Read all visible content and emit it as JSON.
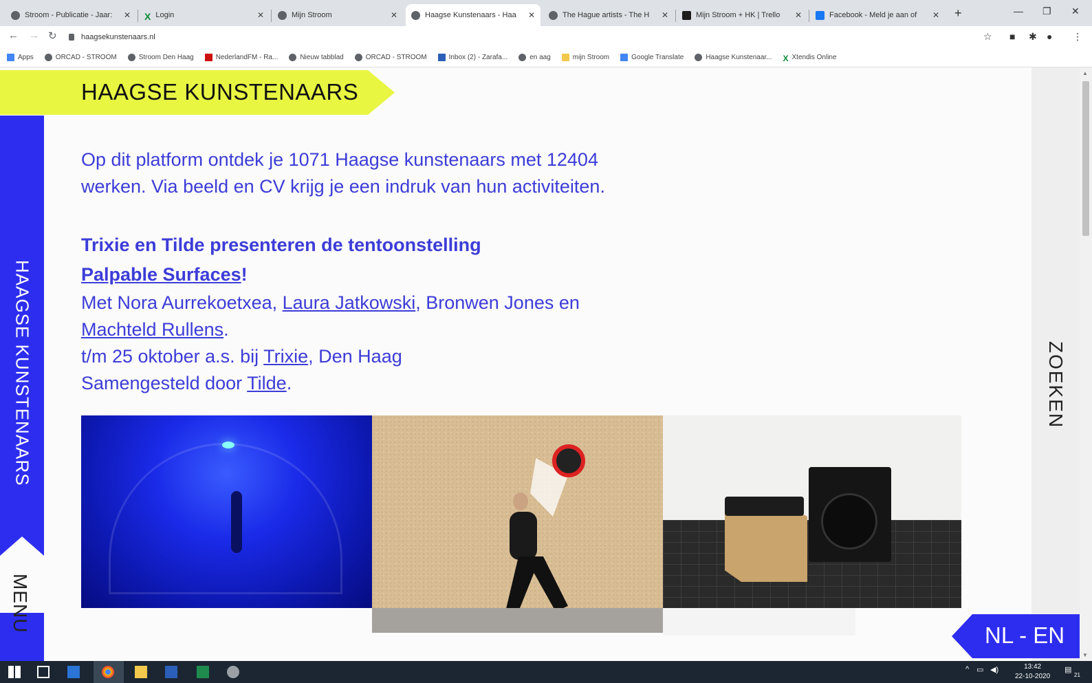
{
  "browser": {
    "tabs": [
      {
        "title": "Stroom - Publicatie - Jaar:",
        "icon": "globe-icon"
      },
      {
        "title": "Login",
        "icon": "x-icon"
      },
      {
        "title": "Mijn Stroom",
        "icon": "globe-icon"
      },
      {
        "title": "Haagse Kunstenaars - Haa",
        "icon": "globe-icon",
        "active": true
      },
      {
        "title": "The Hague artists - The H",
        "icon": "globe-icon"
      },
      {
        "title": "Mijn Stroom + HK | Trello",
        "icon": "trello-icon"
      },
      {
        "title": "Facebook - Meld je aan of",
        "icon": "facebook-icon"
      }
    ],
    "url": "haagsekunstenaars.nl",
    "bookmarks": [
      {
        "label": "Apps",
        "icon": "apps-grid-icon"
      },
      {
        "label": "ORCAD - STROOM",
        "icon": "globe-icon"
      },
      {
        "label": "Stroom Den Haag",
        "icon": "globe-icon"
      },
      {
        "label": "NederlandFM - Ra...",
        "icon": "nl-flag-icon"
      },
      {
        "label": "Nieuw tabblad",
        "icon": "globe-icon"
      },
      {
        "label": "ORCAD - STROOM",
        "icon": "globe-icon"
      },
      {
        "label": "Inbox (2) - Zarafa...",
        "icon": "mail-icon"
      },
      {
        "label": "en aag",
        "icon": "globe-icon"
      },
      {
        "label": "mijn Stroom",
        "icon": "folder-icon"
      },
      {
        "label": "Google Translate",
        "icon": "translate-icon"
      },
      {
        "label": "Haagse Kunstenaar...",
        "icon": "globe-icon"
      },
      {
        "label": "Xtendis Online",
        "icon": "x-icon"
      }
    ]
  },
  "site": {
    "banner_title": "HAAGSE KUNSTENAARS",
    "sidebar_title": "HAAGSE KUNSTENAARS",
    "menu_label": "MENU",
    "search_label": "ZOEKEN",
    "lang_label": "NL - EN",
    "accent_color": "#2d2df0",
    "banner_color": "#e8f642"
  },
  "intro": {
    "text": "Op dit platform ontdek je 1071 Haagse kunstenaars met 12404 werken. Via beeld en CV krijg je een indruk van hun activiteiten."
  },
  "feature": {
    "heading": "Trixie en Tilde presenteren de tentoonstelling",
    "link_title": "Palpable Surfaces",
    "excl": "!",
    "line1_prefix": "Met Nora Aurrekoetxea, ",
    "artist_link_1": "Laura Jatkowski",
    "line1_suffix": ", Bronwen Jones en",
    "artist_link_2": "Machteld Rullens",
    "line2_suffix": ".",
    "line3_prefix": "t/m 25 oktober a.s. bij ",
    "venue_link": "Trixie",
    "line3_suffix": ", Den Haag",
    "line4_prefix": "Samengesteld door ",
    "curator_link": "Tilde",
    "line4_suffix": "."
  },
  "taskbar": {
    "time": "13:42",
    "date": "22-10-2020",
    "notifications": "21"
  }
}
